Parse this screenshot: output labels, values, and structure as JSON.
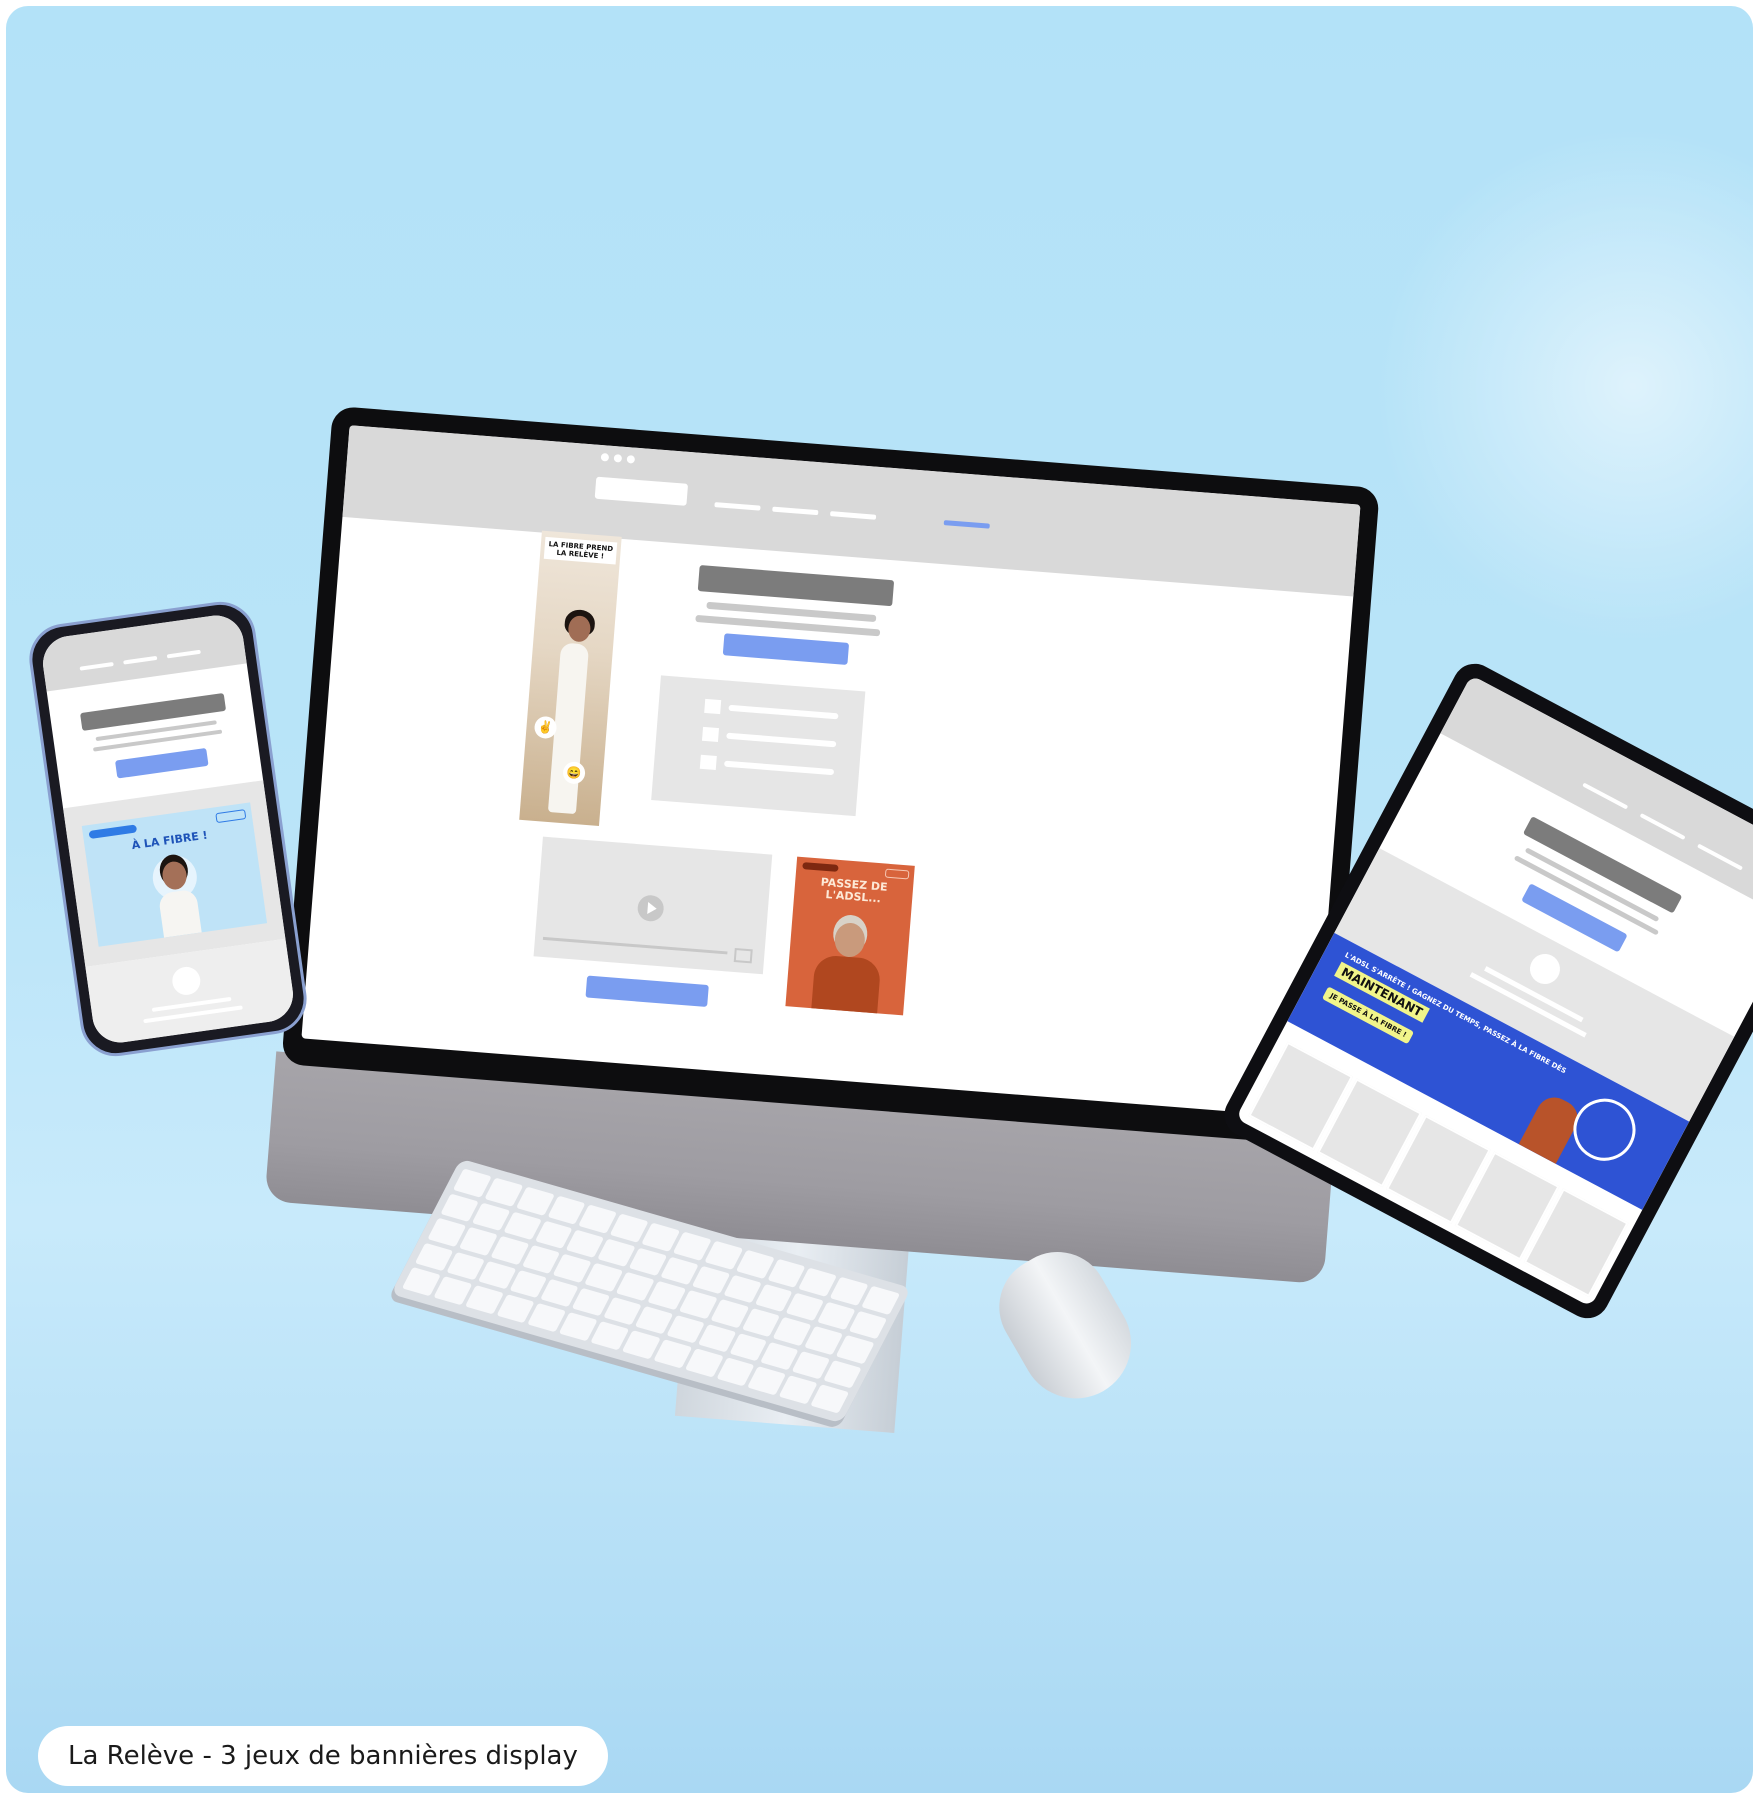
{
  "caption": "La Relève - 3 jeux de bannières display",
  "desktop": {
    "vertical_banner_heading": "LA FIBRE PREND LA RELÈVE !",
    "square_banner_heading": "PASSEZ DE L'ADSL...",
    "emoji_1": "✌",
    "emoji_2": "😄"
  },
  "phone": {
    "banner_heading": "À LA FIBRE !"
  },
  "tablet": {
    "banner_small_text": "L'ADSL S'ARRÊTE ! GAGNEZ DU TEMPS, PASSEZ À LA FIBRE DÈS",
    "banner_big_text": "MAINTENANT",
    "banner_cta": "JE PASSE À LA FIBRE !"
  },
  "colors": {
    "background": "#b3e2f8",
    "accent_blue": "#7a9df0",
    "tablet_banner": "#2e53d4",
    "orange_banner": "#d8643c",
    "highlight_yellow": "#f1f58a"
  }
}
